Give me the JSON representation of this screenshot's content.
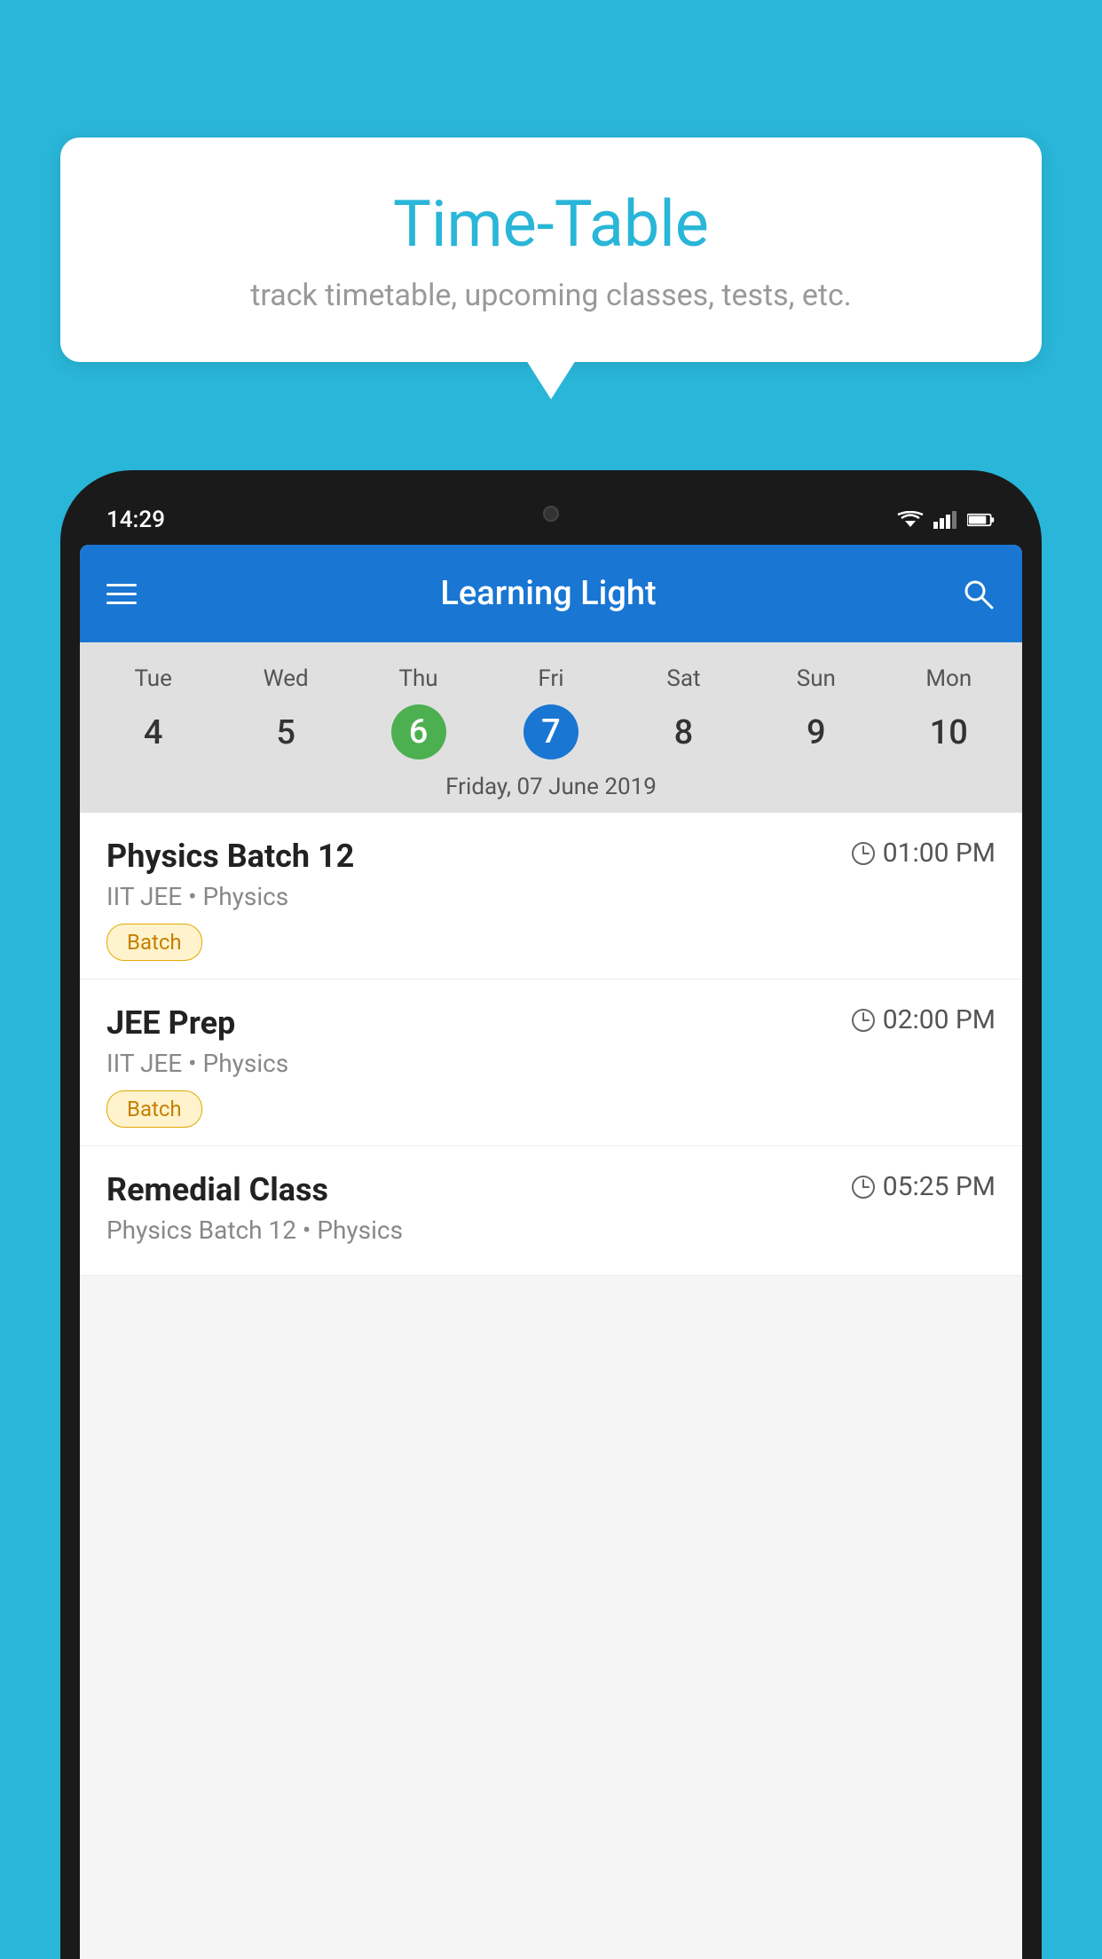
{
  "background_color": "#29b6d8",
  "bubble": {
    "title": "Time-Table",
    "subtitle": "track timetable, upcoming classes, tests, etc."
  },
  "status_bar": {
    "time": "14:29"
  },
  "app_bar": {
    "title": "Learning Light"
  },
  "calendar": {
    "days": [
      {
        "abbr": "Tue",
        "num": "4"
      },
      {
        "abbr": "Wed",
        "num": "5"
      },
      {
        "abbr": "Thu",
        "num": "6",
        "state": "today"
      },
      {
        "abbr": "Fri",
        "num": "7",
        "state": "selected"
      },
      {
        "abbr": "Sat",
        "num": "8"
      },
      {
        "abbr": "Sun",
        "num": "9"
      },
      {
        "abbr": "Mon",
        "num": "10"
      }
    ],
    "selected_date_label": "Friday, 07 June 2019"
  },
  "schedule": {
    "items": [
      {
        "title": "Physics Batch 12",
        "time": "01:00 PM",
        "sub": "IIT JEE • Physics",
        "badge": "Batch"
      },
      {
        "title": "JEE Prep",
        "time": "02:00 PM",
        "sub": "IIT JEE • Physics",
        "badge": "Batch"
      },
      {
        "title": "Remedial Class",
        "time": "05:25 PM",
        "sub": "Physics Batch 12 • Physics",
        "badge": null
      }
    ]
  }
}
